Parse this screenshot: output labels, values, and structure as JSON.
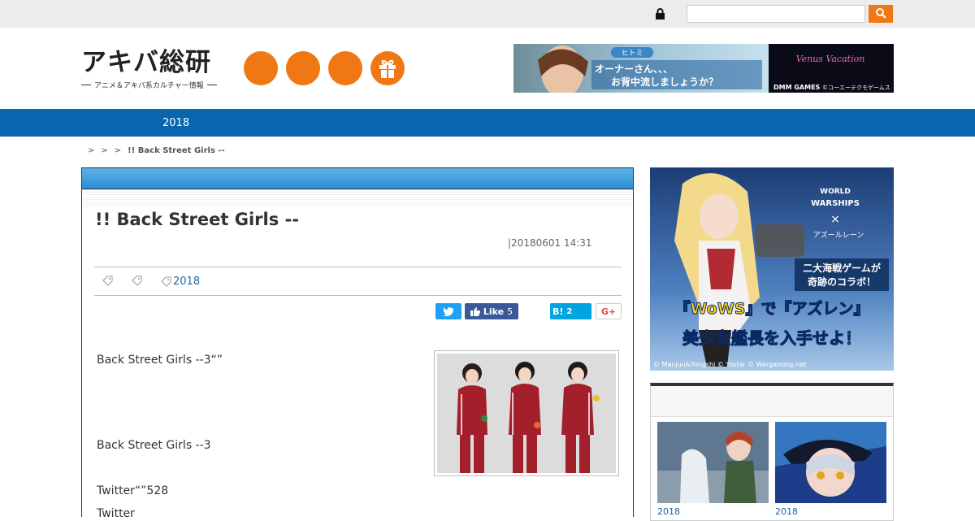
{
  "site": {
    "logo_text": "アキバ総研",
    "logo_tagline": "アニメ＆アキバ系カルチャー情報"
  },
  "topbar": {
    "search_value": "",
    "lock_icon": "lock-icon",
    "search_icon": "search-icon"
  },
  "header_banner": {
    "character_name": "ヒトミ",
    "line1": "オーナーさん、、、",
    "line2": "お背中流しましょうか？",
    "game_logo": "Venus Vacation",
    "brand": "DMM GAMES",
    "copyright": "©コーエーテクモゲームス"
  },
  "nav": {
    "items": [
      "2018"
    ]
  },
  "breadcrumb": {
    "separators": [
      ">",
      ">",
      ">"
    ],
    "current": "!! Back Street Girls --"
  },
  "article": {
    "title": "!! Back Street Girls --",
    "date": "|20180601 14:31",
    "tags": [
      "",
      "",
      "2018"
    ],
    "share": {
      "twitter_icon": "twitter-icon",
      "fb_label": "Like",
      "fb_count": "5",
      "hatena_label": "B!",
      "hatena_count": "2",
      "gplus_label": "G+"
    },
    "paragraphs": [
      "Back Street Girls --3“”",
      "Back Street Girls --3",
      "Twitter“”528",
      "Twitter"
    ]
  },
  "side_ad": {
    "game_logo_line1": "WORLD",
    "game_logo_line2": "WARSHIPS",
    "cross": "×",
    "collab_game": "アズールレーン",
    "tagline1": "二大海戦ゲームが",
    "tagline2": "奇跡のコラボ！",
    "headline1": "『WoWS』で『アズレン』",
    "headline2": "美少女艦長を入手せよ！",
    "copyright": "© Manjuu&Yongshi © Yostar © Wargaming.net"
  },
  "sidebar": {
    "box_title": "",
    "thumbs": [
      {
        "caption": "2018"
      },
      {
        "caption": "2018"
      }
    ]
  },
  "colors": {
    "accent": "#f07814",
    "nav": "#0866ae",
    "link": "#1c63a8"
  }
}
